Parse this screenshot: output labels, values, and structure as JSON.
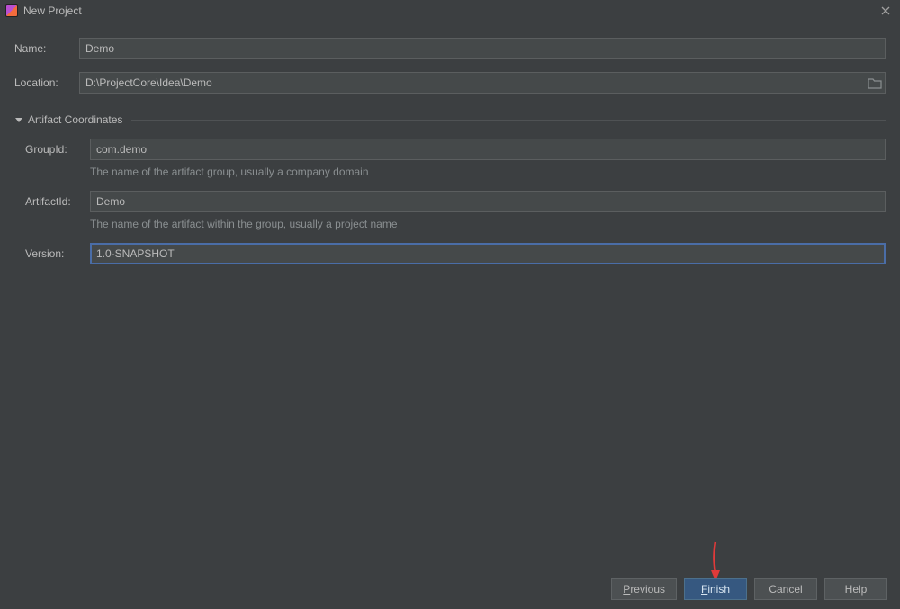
{
  "titlebar": {
    "title": "New Project"
  },
  "fields": {
    "name_label": "Name:",
    "name_value": "Demo",
    "location_label": "Location:",
    "location_value": "D:\\ProjectCore\\Idea\\Demo"
  },
  "artifact": {
    "section_title": "Artifact Coordinates",
    "group_label": "GroupId:",
    "group_value": "com.demo",
    "group_hint": "The name of the artifact group, usually a company domain",
    "artifact_label": "ArtifactId:",
    "artifact_value": "Demo",
    "artifact_hint": "The name of the artifact within the group, usually a project name",
    "version_label": "Version:",
    "version_value": "1.0-SNAPSHOT"
  },
  "buttons": {
    "previous_mnemonic": "P",
    "previous_rest": "revious",
    "finish_mnemonic": "F",
    "finish_rest": "inish",
    "cancel": "Cancel",
    "help": "Help"
  }
}
